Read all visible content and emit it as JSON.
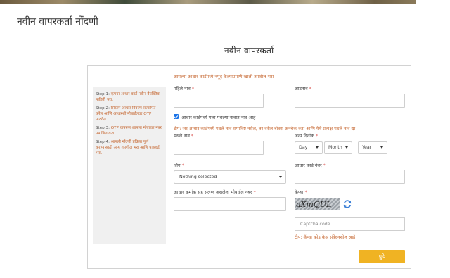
{
  "page": {
    "heading": "नवीन वापरकर्ता नोंदणी",
    "form_title": "नवीन वापरकर्ता"
  },
  "instructions": {
    "aadhaar_note": "आपल्या आधार कार्डमध्ये नमूद केल्याप्रमाणे खाली तपशील भरा"
  },
  "steps": [
    {
      "num": "Step 1:",
      "text": "कृपया आधार कार्ड नवीन वैयक्तिक माहिती भरा."
    },
    {
      "num": "Step 2:",
      "text": "सिस्टम आधार विवरण सत्यापित करेल आणि आधारशी मोबाईलवर OTP पाठवेल."
    },
    {
      "num": "Step 3:",
      "text": "OTP वापरून आपला मोबाइल नंबर प्रमाणित करा."
    },
    {
      "num": "Step 4:",
      "text": "आपली नोंदणी प्रक्रिया पूर्ण करण्यासाठी अन्य तपशील भरा आणि पासवर्ड भरा."
    }
  ],
  "fields": {
    "first_name_label": "पहिले नाव",
    "surname_label": "आडनाव",
    "no_middle_name_label": "आधार कार्डमध्ये मला मधल्या नावात नाव आहे",
    "middle_name_note": "टीप: जर आधार कार्डमध्ये मधले नाव समाविष्ट नसेल, तर वरील बॉक्स अनचेक करा आणि येथे प्रत्यक्ष मधले नाव द्या",
    "middle_name_label": "मधले नाव",
    "dob_label": "जन्म दिनांक",
    "dob_day": "Day",
    "dob_month": "Month",
    "dob_year": "Year",
    "gender_label": "लिंग",
    "gender_value": "Nothing selected",
    "aadhaar_label": "आधार कार्ड नंबर",
    "mobile_label": "आधार क्रमांक सह संलग्न असलेला मोबाईल नंबर",
    "captcha_label": "कॅप्चा",
    "captcha_text": "aXmQUL",
    "captcha_placeholder": "Captcha code",
    "captcha_note": "टीप: कॅप्चा कोड केस संवेदनशील आहे.",
    "required_mark": "*"
  },
  "actions": {
    "submit_label": "पुढे"
  },
  "colors": {
    "accent": "#f0b323",
    "note": "#c4622a",
    "checkbox": "#1a73e8"
  }
}
